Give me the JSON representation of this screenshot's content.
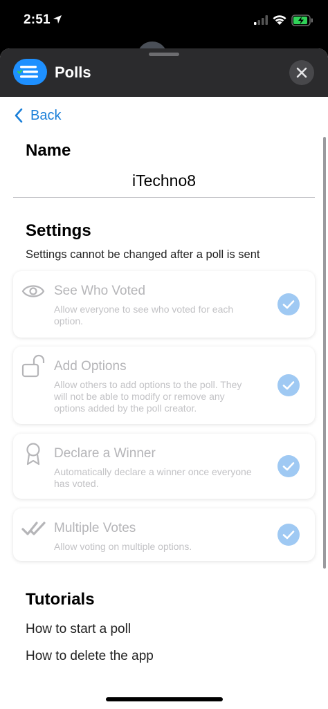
{
  "status_bar": {
    "time": "2:51"
  },
  "header": {
    "title": "Polls"
  },
  "nav": {
    "back_label": "Back"
  },
  "name_section": {
    "title": "Name",
    "value": "iTechno8"
  },
  "settings_section": {
    "title": "Settings",
    "subtitle": "Settings cannot be changed after a poll is sent",
    "options": [
      {
        "title": "See Who Voted",
        "description": "Allow everyone to see who voted for each option.",
        "checked": true,
        "icon": "eye-icon"
      },
      {
        "title": "Add Options",
        "description": "Allow others to add options to the poll. They will not be able to modify or remove any options added by the poll creator.",
        "checked": true,
        "icon": "unlock-icon"
      },
      {
        "title": "Declare a Winner",
        "description": "Automatically declare a winner once everyone has voted.",
        "checked": true,
        "icon": "award-icon"
      },
      {
        "title": "Multiple Votes",
        "description": "Allow voting on multiple options.",
        "checked": true,
        "icon": "double-check-icon"
      }
    ]
  },
  "tutorials_section": {
    "title": "Tutorials",
    "links": [
      "How to start a poll",
      "How to delete the app"
    ]
  },
  "colors": {
    "accent": "#1a7fd9",
    "check": "#9fc9f3",
    "header_bg": "#2b2b2d"
  }
}
